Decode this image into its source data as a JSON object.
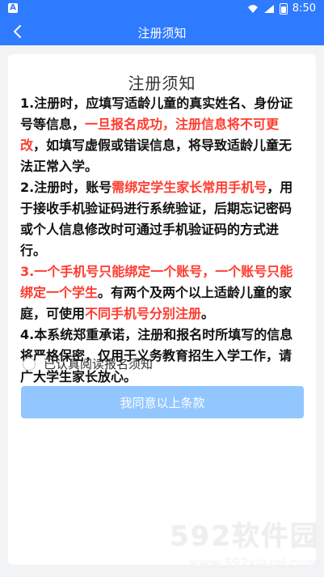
{
  "status": {
    "time": "8:50",
    "left_badge": "A"
  },
  "appbar": {
    "title": "注册须知",
    "back_icon": "chevron-left-icon"
  },
  "card": {
    "heading": "注册须知",
    "paragraphs": [
      {
        "parts": [
          {
            "text": "1.注册时，应填写适龄儿童的真实姓名、身份证号等信息，",
            "red": false
          },
          {
            "text": "一旦报名成功，注册信息将不可更改",
            "red": true
          },
          {
            "text": "，如填写虚假或错误信息，将导致适龄儿童无法正常入学。",
            "red": false
          }
        ]
      },
      {
        "parts": [
          {
            "text": "2.注册时，账号",
            "red": false
          },
          {
            "text": "需绑定学生家长常用手机号",
            "red": true
          },
          {
            "text": "，用于接收手机验证码进行系统验证，后期忘记密码或个人信息修改时可通过手机验证码的方式进行。",
            "red": false
          }
        ]
      },
      {
        "parts": [
          {
            "text": "3.一个手机号只能绑定一个账号，一个账号只能绑定一个学生",
            "red": true
          },
          {
            "text": "。有两个及两个以上适龄儿童的家庭，可使用",
            "red": false
          },
          {
            "text": "不同手机号分别注册",
            "red": true
          },
          {
            "text": "。",
            "red": false
          }
        ]
      },
      {
        "parts": [
          {
            "text": "4.本系统郑重承诺，注册和报名时所填写的信息将严格保密，仅用于义务教育招生入学工作，请广大学生家长放心。",
            "red": false
          }
        ]
      }
    ],
    "agree_label": "已认真阅读报名须知",
    "button_label": "我同意以上条款"
  },
  "watermark": {
    "big": "592软件园",
    "small": "www.592xiazai.com"
  },
  "colors": {
    "primary": "#2f7bff",
    "button": "#92c6ff",
    "red": "#ff3b2f"
  }
}
